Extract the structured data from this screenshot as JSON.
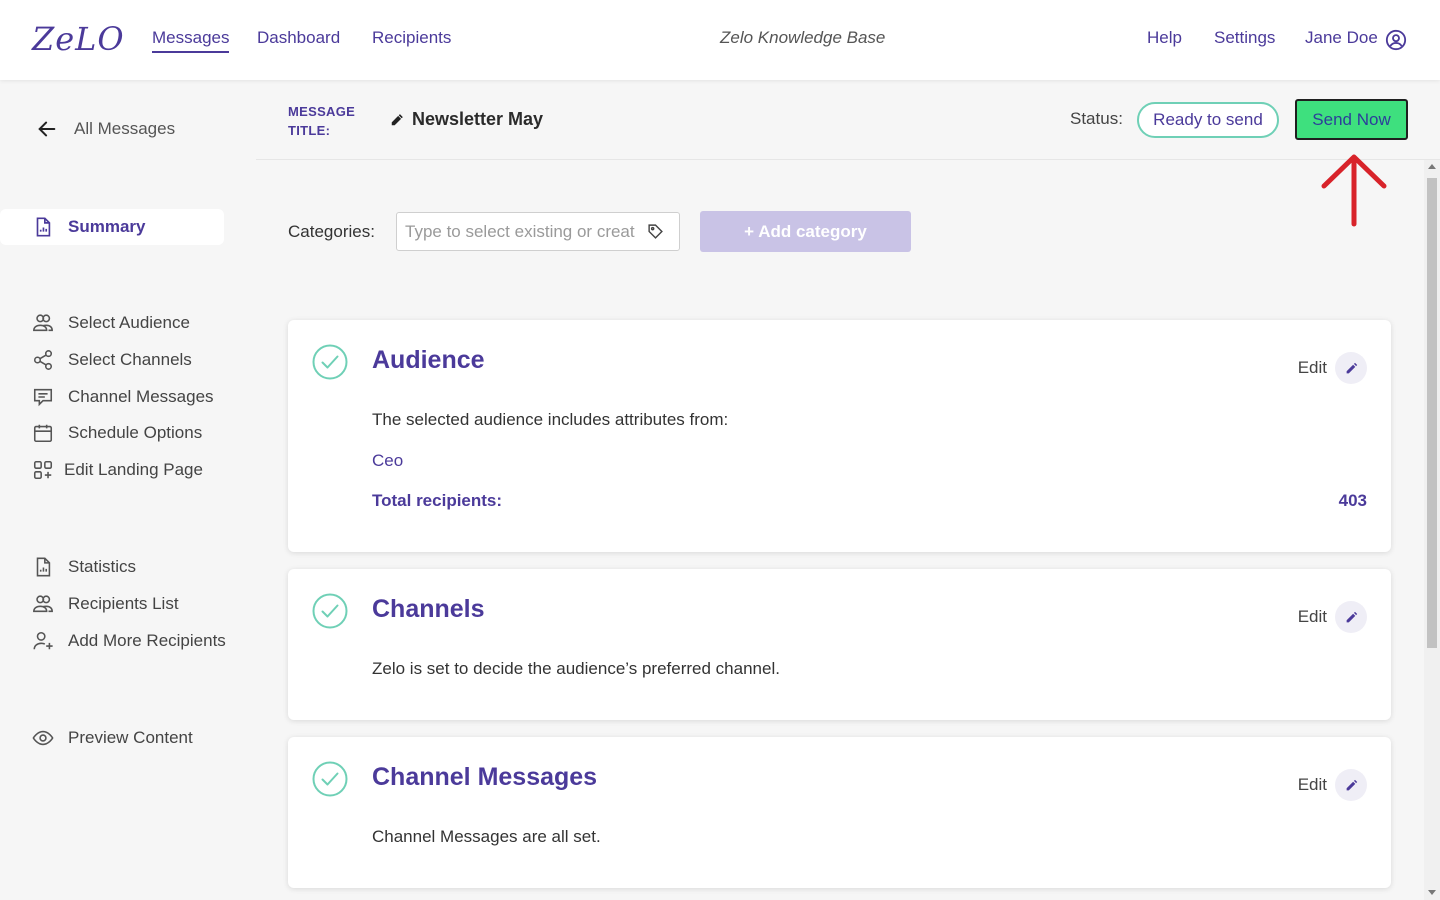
{
  "topbar": {
    "logo": "ZeLO",
    "nav": [
      {
        "label": "Messages",
        "active": true
      },
      {
        "label": "Dashboard",
        "active": false
      },
      {
        "label": "Recipients",
        "active": false
      }
    ],
    "knowledge_base": "Zelo Knowledge Base",
    "help": "Help",
    "settings": "Settings",
    "user_name": "Jane Doe"
  },
  "sidebar": {
    "back_label": "All Messages",
    "summary": "Summary",
    "group1": [
      "Select Audience",
      "Select Channels",
      "Channel Messages",
      "Schedule Options",
      "Edit Landing Page"
    ],
    "group2": [
      "Statistics",
      "Recipients List",
      "Add More Recipients"
    ],
    "group3": [
      "Preview Content"
    ]
  },
  "header": {
    "title_label_line1": "MESSAGE",
    "title_label_line2": "TITLE:",
    "title": "Newsletter May",
    "status_label": "Status:",
    "status_value": "Ready to send",
    "send_button": "Send Now"
  },
  "categories": {
    "label": "Categories:",
    "placeholder": "Type to select existing or create new",
    "add_button": "+ Add category"
  },
  "cards": {
    "audience": {
      "title": "Audience",
      "edit": "Edit",
      "description": "The selected audience includes attributes from:",
      "attribute": "Ceo",
      "total_label": "Total recipients:",
      "total_value": "403"
    },
    "channels": {
      "title": "Channels",
      "edit": "Edit",
      "description": "Zelo is set to decide the audience’s preferred channel."
    },
    "channel_messages": {
      "title": "Channel Messages",
      "edit": "Edit",
      "description": "Channel Messages are all set."
    }
  },
  "colors": {
    "brand": "#4b3a9a",
    "send_button_bg": "#3ee07e",
    "status_border": "#6fd0b6",
    "check": "#6fd0b6",
    "annotation_arrow": "#d8232a"
  }
}
